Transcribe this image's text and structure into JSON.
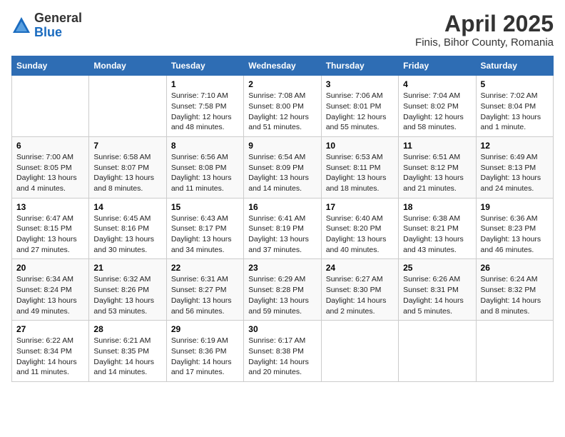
{
  "logo": {
    "general": "General",
    "blue": "Blue"
  },
  "title": "April 2025",
  "subtitle": "Finis, Bihor County, Romania",
  "weekdays": [
    "Sunday",
    "Monday",
    "Tuesday",
    "Wednesday",
    "Thursday",
    "Friday",
    "Saturday"
  ],
  "weeks": [
    [
      null,
      null,
      {
        "day": "1",
        "sunrise": "Sunrise: 7:10 AM",
        "sunset": "Sunset: 7:58 PM",
        "daylight": "Daylight: 12 hours and 48 minutes."
      },
      {
        "day": "2",
        "sunrise": "Sunrise: 7:08 AM",
        "sunset": "Sunset: 8:00 PM",
        "daylight": "Daylight: 12 hours and 51 minutes."
      },
      {
        "day": "3",
        "sunrise": "Sunrise: 7:06 AM",
        "sunset": "Sunset: 8:01 PM",
        "daylight": "Daylight: 12 hours and 55 minutes."
      },
      {
        "day": "4",
        "sunrise": "Sunrise: 7:04 AM",
        "sunset": "Sunset: 8:02 PM",
        "daylight": "Daylight: 12 hours and 58 minutes."
      },
      {
        "day": "5",
        "sunrise": "Sunrise: 7:02 AM",
        "sunset": "Sunset: 8:04 PM",
        "daylight": "Daylight: 13 hours and 1 minute."
      }
    ],
    [
      {
        "day": "6",
        "sunrise": "Sunrise: 7:00 AM",
        "sunset": "Sunset: 8:05 PM",
        "daylight": "Daylight: 13 hours and 4 minutes."
      },
      {
        "day": "7",
        "sunrise": "Sunrise: 6:58 AM",
        "sunset": "Sunset: 8:07 PM",
        "daylight": "Daylight: 13 hours and 8 minutes."
      },
      {
        "day": "8",
        "sunrise": "Sunrise: 6:56 AM",
        "sunset": "Sunset: 8:08 PM",
        "daylight": "Daylight: 13 hours and 11 minutes."
      },
      {
        "day": "9",
        "sunrise": "Sunrise: 6:54 AM",
        "sunset": "Sunset: 8:09 PM",
        "daylight": "Daylight: 13 hours and 14 minutes."
      },
      {
        "day": "10",
        "sunrise": "Sunrise: 6:53 AM",
        "sunset": "Sunset: 8:11 PM",
        "daylight": "Daylight: 13 hours and 18 minutes."
      },
      {
        "day": "11",
        "sunrise": "Sunrise: 6:51 AM",
        "sunset": "Sunset: 8:12 PM",
        "daylight": "Daylight: 13 hours and 21 minutes."
      },
      {
        "day": "12",
        "sunrise": "Sunrise: 6:49 AM",
        "sunset": "Sunset: 8:13 PM",
        "daylight": "Daylight: 13 hours and 24 minutes."
      }
    ],
    [
      {
        "day": "13",
        "sunrise": "Sunrise: 6:47 AM",
        "sunset": "Sunset: 8:15 PM",
        "daylight": "Daylight: 13 hours and 27 minutes."
      },
      {
        "day": "14",
        "sunrise": "Sunrise: 6:45 AM",
        "sunset": "Sunset: 8:16 PM",
        "daylight": "Daylight: 13 hours and 30 minutes."
      },
      {
        "day": "15",
        "sunrise": "Sunrise: 6:43 AM",
        "sunset": "Sunset: 8:17 PM",
        "daylight": "Daylight: 13 hours and 34 minutes."
      },
      {
        "day": "16",
        "sunrise": "Sunrise: 6:41 AM",
        "sunset": "Sunset: 8:19 PM",
        "daylight": "Daylight: 13 hours and 37 minutes."
      },
      {
        "day": "17",
        "sunrise": "Sunrise: 6:40 AM",
        "sunset": "Sunset: 8:20 PM",
        "daylight": "Daylight: 13 hours and 40 minutes."
      },
      {
        "day": "18",
        "sunrise": "Sunrise: 6:38 AM",
        "sunset": "Sunset: 8:21 PM",
        "daylight": "Daylight: 13 hours and 43 minutes."
      },
      {
        "day": "19",
        "sunrise": "Sunrise: 6:36 AM",
        "sunset": "Sunset: 8:23 PM",
        "daylight": "Daylight: 13 hours and 46 minutes."
      }
    ],
    [
      {
        "day": "20",
        "sunrise": "Sunrise: 6:34 AM",
        "sunset": "Sunset: 8:24 PM",
        "daylight": "Daylight: 13 hours and 49 minutes."
      },
      {
        "day": "21",
        "sunrise": "Sunrise: 6:32 AM",
        "sunset": "Sunset: 8:26 PM",
        "daylight": "Daylight: 13 hours and 53 minutes."
      },
      {
        "day": "22",
        "sunrise": "Sunrise: 6:31 AM",
        "sunset": "Sunset: 8:27 PM",
        "daylight": "Daylight: 13 hours and 56 minutes."
      },
      {
        "day": "23",
        "sunrise": "Sunrise: 6:29 AM",
        "sunset": "Sunset: 8:28 PM",
        "daylight": "Daylight: 13 hours and 59 minutes."
      },
      {
        "day": "24",
        "sunrise": "Sunrise: 6:27 AM",
        "sunset": "Sunset: 8:30 PM",
        "daylight": "Daylight: 14 hours and 2 minutes."
      },
      {
        "day": "25",
        "sunrise": "Sunrise: 6:26 AM",
        "sunset": "Sunset: 8:31 PM",
        "daylight": "Daylight: 14 hours and 5 minutes."
      },
      {
        "day": "26",
        "sunrise": "Sunrise: 6:24 AM",
        "sunset": "Sunset: 8:32 PM",
        "daylight": "Daylight: 14 hours and 8 minutes."
      }
    ],
    [
      {
        "day": "27",
        "sunrise": "Sunrise: 6:22 AM",
        "sunset": "Sunset: 8:34 PM",
        "daylight": "Daylight: 14 hours and 11 minutes."
      },
      {
        "day": "28",
        "sunrise": "Sunrise: 6:21 AM",
        "sunset": "Sunset: 8:35 PM",
        "daylight": "Daylight: 14 hours and 14 minutes."
      },
      {
        "day": "29",
        "sunrise": "Sunrise: 6:19 AM",
        "sunset": "Sunset: 8:36 PM",
        "daylight": "Daylight: 14 hours and 17 minutes."
      },
      {
        "day": "30",
        "sunrise": "Sunrise: 6:17 AM",
        "sunset": "Sunset: 8:38 PM",
        "daylight": "Daylight: 14 hours and 20 minutes."
      },
      null,
      null,
      null
    ]
  ]
}
